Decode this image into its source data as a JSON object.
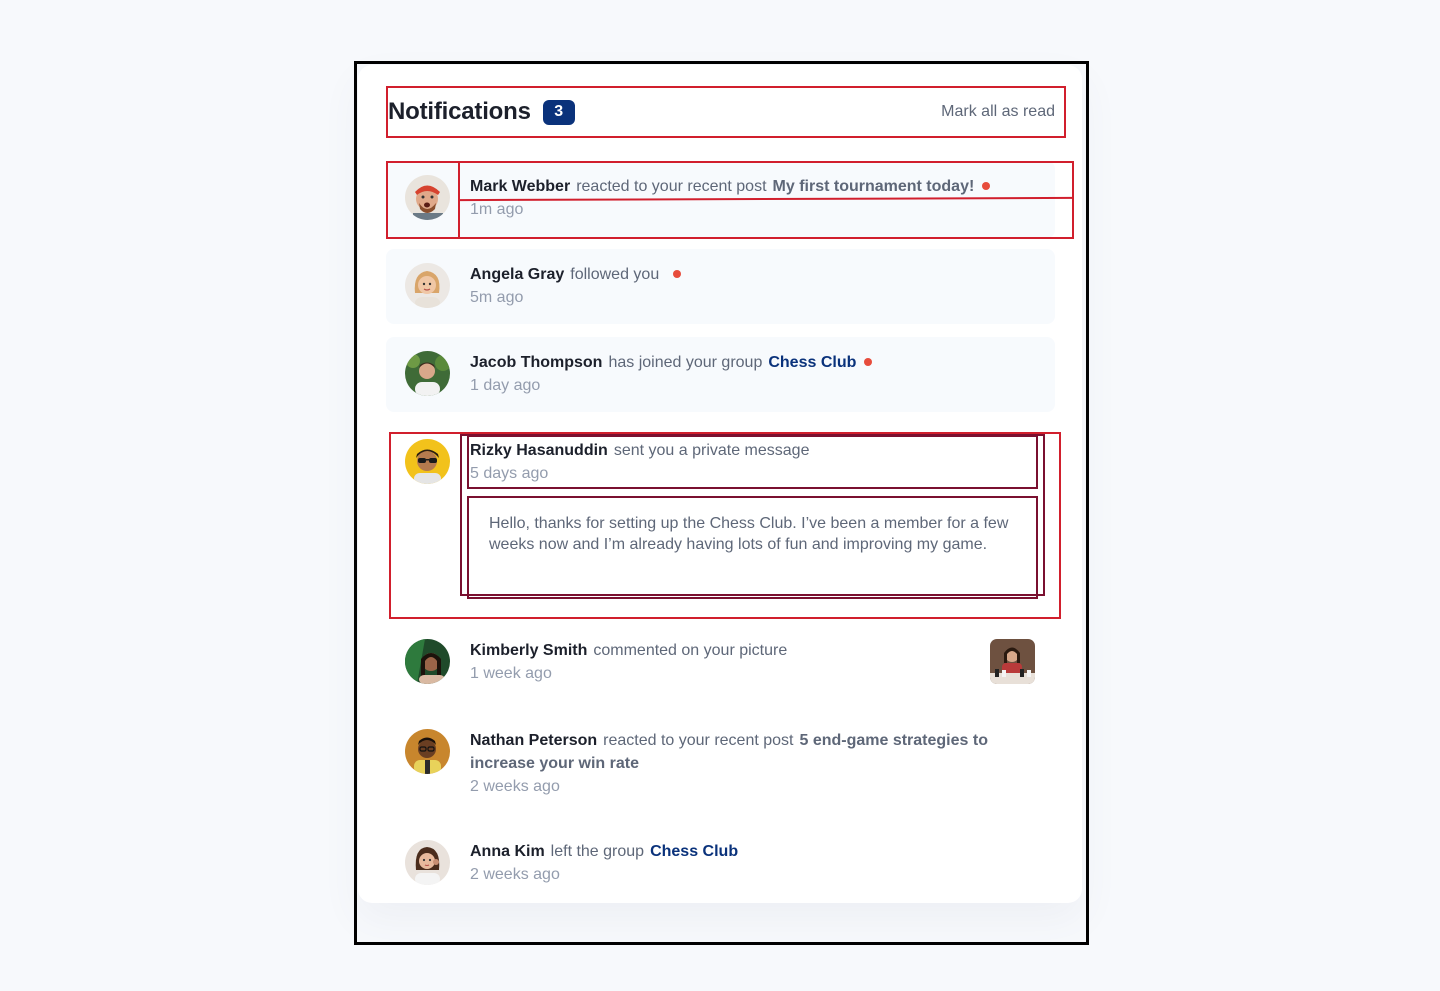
{
  "header": {
    "title": "Notifications",
    "count": "3",
    "mark_all_label": "Mark all as read"
  },
  "colors": {
    "accent": "#0a327b",
    "unread_dot": "#e74c3c",
    "unread_bg": "#f7fafd",
    "highlight_red": "#d11f2d",
    "highlight_dark": "#7a1030"
  },
  "notifications": [
    {
      "name": "Mark Webber",
      "action": "reacted to your recent post",
      "post": "My first tournament today!",
      "time": "1m ago",
      "unread": true,
      "avatar_icon": "avatar-mark-webber"
    },
    {
      "name": "Angela Gray",
      "action": "followed you",
      "time": "5m ago",
      "unread": true,
      "avatar_icon": "avatar-angela-gray"
    },
    {
      "name": "Jacob Thompson",
      "action": "has joined your group",
      "group": "Chess Club",
      "time": "1 day ago",
      "unread": true,
      "avatar_icon": "avatar-jacob-thompson"
    },
    {
      "name": "Rizky Hasanuddin",
      "action": "sent you a private message",
      "time": "5 days ago",
      "unread": false,
      "message": "Hello, thanks for setting up the Chess Club. I’ve been a member for a few weeks now and I’m already having lots of fun and improving my game.",
      "avatar_icon": "avatar-rizky-hasanuddin"
    },
    {
      "name": "Kimberly Smith",
      "action": "commented on your picture",
      "time": "1 week ago",
      "unread": false,
      "avatar_icon": "avatar-kimberly-smith",
      "thumbnail_icon": "chess-picture-thumbnail"
    },
    {
      "name": "Nathan Peterson",
      "action": "reacted to your recent post",
      "post": "5 end-game strategies to increase your win rate",
      "time": "2 weeks ago",
      "unread": false,
      "avatar_icon": "avatar-nathan-peterson"
    },
    {
      "name": "Anna Kim",
      "action": "left the group",
      "group": "Chess Club",
      "time": "2 weeks ago",
      "unread": false,
      "avatar_icon": "avatar-anna-kim"
    }
  ]
}
